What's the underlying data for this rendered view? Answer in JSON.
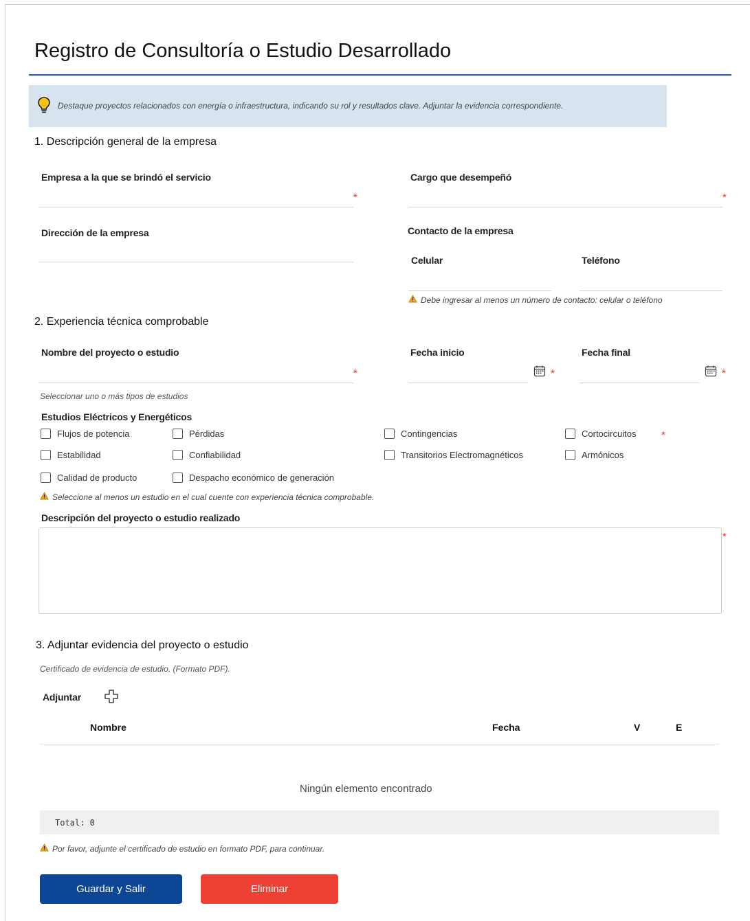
{
  "title": "Registro de Consultoría o Estudio Desarrollado",
  "tip": "Destaque proyectos relacionados con energía o infraestructura, indicando su rol y resultados clave. Adjuntar la evidencia correspondiente.",
  "section1": {
    "heading": "1. Descripción general de la empresa",
    "empresa_label": "Empresa a la que se brindó el servicio",
    "cargo_label": "Cargo que desempeñó",
    "direccion_label": "Dirección de la empresa",
    "contacto_label": "Contacto de la empresa",
    "celular_label": "Celular",
    "telefono_label": "Teléfono",
    "contacto_warning": "Debe ingresar al menos un número de contacto: celular o teléfono"
  },
  "section2": {
    "heading": "2. Experiencia técnica comprobable",
    "proyecto_label": "Nombre del proyecto o estudio",
    "fecha_inicio_label": "Fecha inicio",
    "fecha_final_label": "Fecha final",
    "tipos_hint": "Seleccionar uno o más tipos de estudios",
    "grupo_label": "Estudios Eléctricos y Energéticos",
    "checkboxes": [
      "Flujos de potencia",
      "Pérdidas",
      "Contingencias",
      "Cortocircuitos",
      "Estabilidad",
      "Confiabilidad",
      "Transitorios Electromagnéticos",
      "Armónicos",
      "Calidad de producto",
      "Despacho económico de generación"
    ],
    "estudios_warning": "Seleccione al menos un estudio en el cual cuente con experiencia técnica comprobable.",
    "descripcion_label": "Descripción del proyecto o estudio realizado"
  },
  "section3": {
    "heading": "3. Adjuntar evidencia del proyecto o estudio",
    "hint": "Certificado de evidencia de estudio. (Formato PDF).",
    "adjuntar_label": "Adjuntar",
    "columns": [
      "Nombre",
      "Fecha",
      "V",
      "E"
    ],
    "empty_message": "Ningún elemento encontrado",
    "total": "Total: 0",
    "warning": "Por favor, adjunte el certificado de estudio en formato PDF, para continuar."
  },
  "buttons": {
    "save": "Guardar y Salir",
    "delete": "Eliminar"
  },
  "required_mark": "*",
  "colors": {
    "primary": "#0d4694",
    "danger": "#ee4035",
    "required": "#e0342d",
    "tip_bg": "#d7e4f0",
    "title_rule": "#2656a8",
    "warning_icon": "#e8a317"
  }
}
